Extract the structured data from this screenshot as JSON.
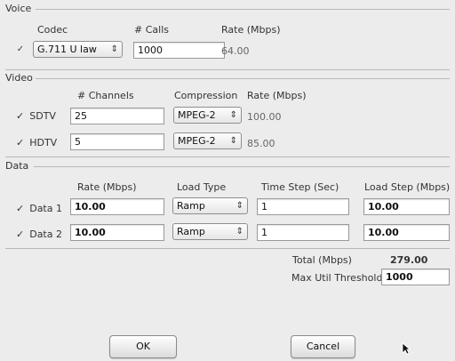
{
  "voice": {
    "section_title": "Voice",
    "headers": {
      "codec": "Codec",
      "calls": "# Calls",
      "rate": "Rate (Mbps)"
    },
    "checked": "✓",
    "codec_value": "G.711 U law",
    "calls_value": "1000",
    "rate_value": "64.00"
  },
  "video": {
    "section_title": "Video",
    "headers": {
      "channels": "# Channels",
      "compression": "Compression",
      "rate": "Rate (Mbps)"
    },
    "rows": [
      {
        "label": "SDTV",
        "checked": "✓",
        "channels": "25",
        "compression": "MPEG-2",
        "rate": "100.00"
      },
      {
        "label": "HDTV",
        "checked": "✓",
        "channels": "5",
        "compression": "MPEG-2",
        "rate": "85.00"
      }
    ]
  },
  "data": {
    "section_title": "Data",
    "headers": {
      "rate": "Rate (Mbps)",
      "load_type": "Load Type",
      "time_step": "Time Step (Sec)",
      "load_step": "Load Step (Mbps)"
    },
    "rows": [
      {
        "label": "Data 1",
        "checked": "✓",
        "rate": "10.00",
        "load_type": "Ramp",
        "time_step": "1",
        "load_step": "10.00"
      },
      {
        "label": "Data 2",
        "checked": "✓",
        "rate": "10.00",
        "load_type": "Ramp",
        "time_step": "1",
        "load_step": "10.00"
      }
    ]
  },
  "summary": {
    "total_label": "Total (Mbps)",
    "total_value": "279.00",
    "threshold_label": "Max Util Threshold",
    "threshold_value": "1000"
  },
  "buttons": {
    "ok": "OK",
    "cancel": "Cancel"
  },
  "select_arrows": "⇕"
}
